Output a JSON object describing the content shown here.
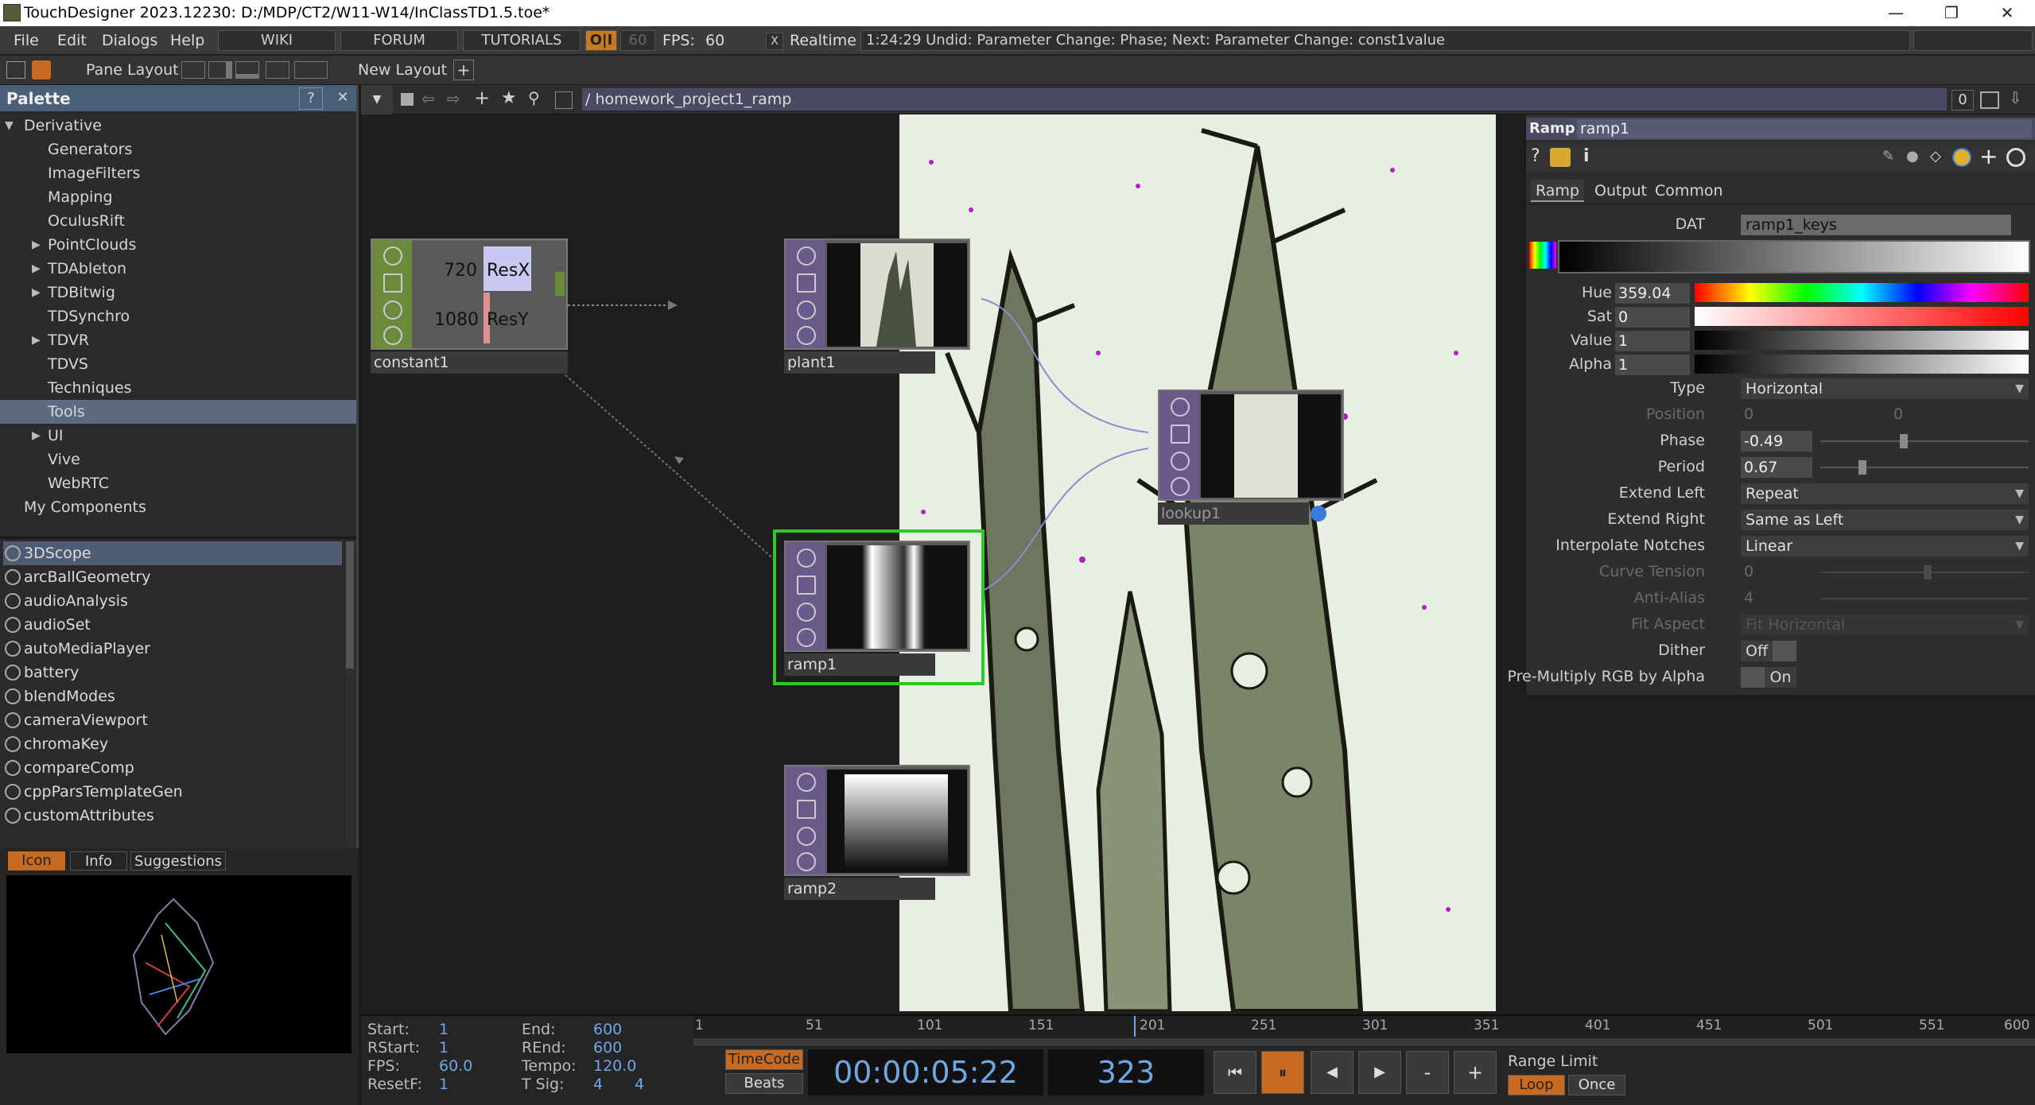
{
  "window": {
    "title": "TouchDesigner 2023.12230: D:/MDP/CT2/W11-W14/InClassTD1.5.toe*",
    "minimize": "—",
    "restore": "❐",
    "close": "✕"
  },
  "menubar": {
    "items": [
      "File",
      "Edit",
      "Dialogs",
      "Help"
    ],
    "wiki": "WIKI",
    "forum": "FORUM",
    "tutorials": "TUTORIALS",
    "oi": "O|I",
    "fps_cap": "60",
    "fps_label": "FPS:",
    "fps_value": "60",
    "realtime_check": "X",
    "realtime_label": "Realtime",
    "status": "1:24:29 Undid: Parameter Change: Phase; Next: Parameter Change: const1value"
  },
  "panebar": {
    "pane_layout": "Pane Layout",
    "new_layout": "New Layout",
    "plus": "+"
  },
  "palette": {
    "title": "Palette",
    "help": "?",
    "close": "✕",
    "tree": [
      {
        "label": "Derivative",
        "expanded": true
      },
      {
        "label": "Generators"
      },
      {
        "label": "ImageFilters"
      },
      {
        "label": "Mapping"
      },
      {
        "label": "OculusRift"
      },
      {
        "label": "PointClouds",
        "collapsed": true
      },
      {
        "label": "TDAbleton",
        "collapsed": true
      },
      {
        "label": "TDBitwig",
        "collapsed": true
      },
      {
        "label": "TDSynchro"
      },
      {
        "label": "TDVR",
        "collapsed": true
      },
      {
        "label": "TDVS"
      },
      {
        "label": "Techniques"
      },
      {
        "label": "Tools",
        "selected": true
      },
      {
        "label": "UI",
        "collapsed": true
      },
      {
        "label": "Vive"
      },
      {
        "label": "WebRTC"
      },
      {
        "label": "My Components"
      }
    ],
    "components": [
      "3DScope",
      "arcBallGeometry",
      "audioAnalysis",
      "audioSet",
      "autoMediaPlayer",
      "battery",
      "blendModes",
      "cameraViewport",
      "chromaKey",
      "compareComp",
      "cppParsTemplateGen",
      "customAttributes"
    ],
    "info_tabs": [
      "Icon",
      "Info",
      "Suggestions"
    ]
  },
  "network": {
    "path": "/ homework_project1_ramp",
    "badge": "0",
    "nodes": {
      "constant1": {
        "name": "constant1",
        "resx_value": "720",
        "resx_label": "ResX",
        "resy_value": "1080",
        "resy_label": "ResY"
      },
      "plant1": {
        "name": "plant1"
      },
      "lookup1": {
        "name": "lookup1"
      },
      "ramp1": {
        "name": "ramp1"
      },
      "ramp2": {
        "name": "ramp2"
      }
    }
  },
  "params": {
    "op_type": "Ramp",
    "op_name": "ramp1",
    "tabs": [
      "Ramp",
      "Output",
      "Common"
    ],
    "dat_label": "DAT",
    "dat_value": "ramp1_keys",
    "hue_label": "Hue",
    "hue_value": "359.04",
    "sat_label": "Sat",
    "sat_value": "0",
    "value_label": "Value",
    "value_value": "1",
    "alpha_label": "Alpha",
    "alpha_value": "1",
    "type_label": "Type",
    "type_value": "Horizontal",
    "position_label": "Position",
    "position_x": "0",
    "position_y": "0",
    "phase_label": "Phase",
    "phase_value": "-0.49",
    "period_label": "Period",
    "period_value": "0.67",
    "extend_left_label": "Extend Left",
    "extend_left_value": "Repeat",
    "extend_right_label": "Extend Right",
    "extend_right_value": "Same as Left",
    "interp_label": "Interpolate Notches",
    "interp_value": "Linear",
    "curve_label": "Curve Tension",
    "curve_value": "0",
    "aa_label": "Anti-Alias",
    "aa_value": "4",
    "fit_label": "Fit Aspect",
    "fit_value": "Fit Horizontal",
    "dither_label": "Dither",
    "dither_value": "Off",
    "premult_label": "Pre-Multiply RGB by Alpha",
    "premult_value": "On"
  },
  "timeline": {
    "start_label": "Start:",
    "start": "1",
    "end_label": "End:",
    "end": "600",
    "rstart_label": "RStart:",
    "rstart": "1",
    "rend_label": "REnd:",
    "rend": "600",
    "fps_label": "FPS:",
    "fps": "60.0",
    "tempo_label": "Tempo:",
    "tempo": "120.0",
    "resetf_label": "ResetF:",
    "resetf": "1",
    "tsig_label": "T Sig:",
    "tsig_a": "4",
    "tsig_b": "4",
    "ticks": [
      "1",
      "51",
      "101",
      "151",
      "201",
      "251",
      "301",
      "351",
      "401",
      "451",
      "501",
      "551",
      "600"
    ],
    "timecode_btn": "TimeCode",
    "beats_btn": "Beats",
    "timecode": "00:00:05:22",
    "frame": "323",
    "range_limit": "Range Limit",
    "loop": "Loop",
    "once": "Once",
    "minus": "-",
    "plus": "+"
  }
}
